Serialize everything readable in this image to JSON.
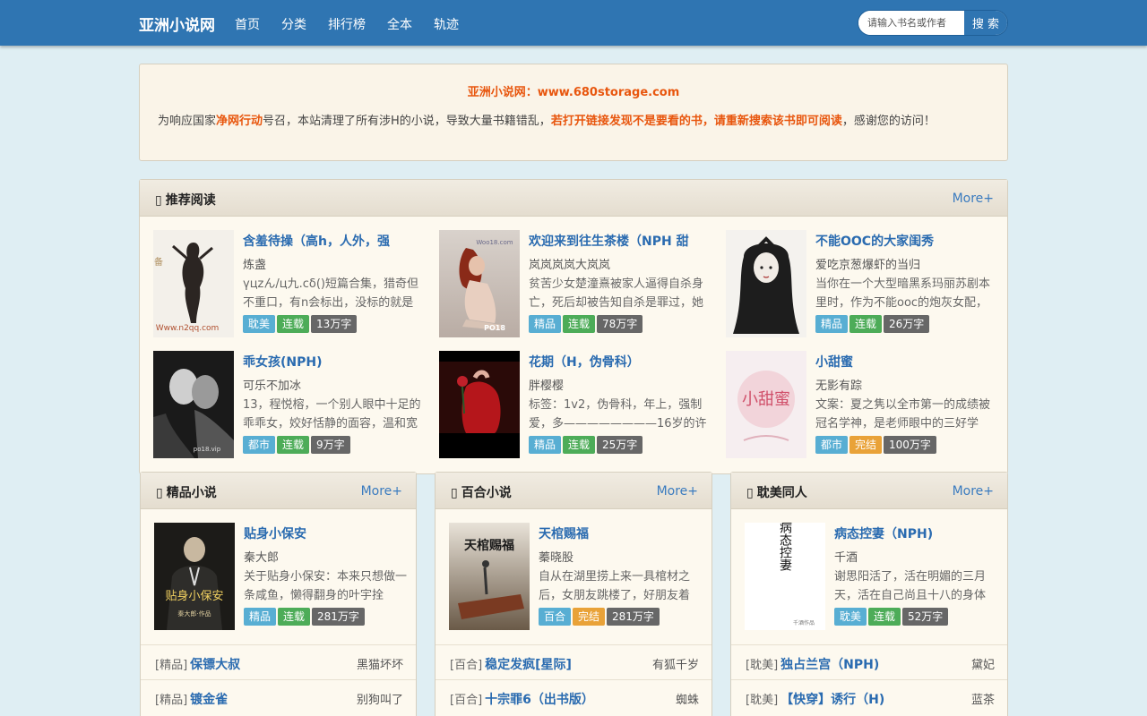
{
  "header": {
    "brand": "亚洲小说网",
    "nav": [
      "首页",
      "分类",
      "排行榜",
      "全本",
      "轨迹"
    ],
    "search_placeholder": "请输入书名或作者",
    "search_button": "搜 索"
  },
  "notice": {
    "title": "亚洲小说网：www.680storage.com",
    "part1": "为响应国家",
    "highlight1": "净网行动",
    "part2": "号召，本站清理了所有涉H的小说，导致大量书籍错乱，",
    "highlight2": "若打开链接发现不是要看的书，请重新搜索该书即可阅读",
    "part3": "，感谢您的访问！"
  },
  "recommend": {
    "title": "推荐阅读",
    "more": "More+",
    "books": [
      {
        "title": "含羞待操（高h，人外，强",
        "author": "炼盏",
        "desc": "үцzん/ц九.cδ()短篇合集，猎奇但不重口，有n会标出，没标的就是",
        "tags": [
          "耽美",
          "连载",
          "13万字"
        ]
      },
      {
        "title": "欢迎来到往生茶楼（NPH 甜",
        "author": "岚岚岚岚大岚岚",
        "desc": "贫苦少女楚潼熹被家人逼得自杀身亡，死后却被告知自杀是罪过，她",
        "tags": [
          "精品",
          "连载",
          "78万字"
        ]
      },
      {
        "title": "不能OOC的大家闺秀",
        "author": "爱吃京葱爆虾的当归",
        "desc": "当你在一个大型暗黑系玛丽苏剧本里时，作为不能ooc的炮灰女配，",
        "tags": [
          "精品",
          "连载",
          "26万字"
        ]
      },
      {
        "title": "乖女孩(NPH)",
        "author": "可乐不加冰",
        "desc": "13，程悦榕，一个别人眼中十足的乖乖女，姣好恬静的面容，温和宽",
        "tags": [
          "都市",
          "连载",
          "9万字"
        ]
      },
      {
        "title": "花期（H，伪骨科）",
        "author": "胖樱樱",
        "desc": "标签：1v2，伪骨科，年上，强制爱，多————————16岁的许",
        "tags": [
          "精品",
          "连载",
          "25万字"
        ]
      },
      {
        "title": "小甜蜜",
        "author": "无影有踪",
        "desc": "文案：夏之隽以全市第一的成绩被冠名学神，是老师眼中的三好学",
        "tags": [
          "都市",
          "完结",
          "100万字"
        ]
      }
    ]
  },
  "sections": [
    {
      "title": "精品小说",
      "more": "More+",
      "featured": {
        "title": "贴身小保安",
        "author": "秦大郎",
        "desc": "关于贴身小保安：本来只想做一条咸鱼，懒得翻身的叶宇拴",
        "tags": [
          "精品",
          "连载",
          "281万字"
        ]
      },
      "list": [
        {
          "cat": "[精品]",
          "title": "保镖大叔",
          "author": "黑猫坏坏"
        },
        {
          "cat": "[精品]",
          "title": "镀金雀",
          "author": "别狗叫了"
        }
      ]
    },
    {
      "title": "百合小说",
      "more": "More+",
      "featured": {
        "title": "天棺赐福",
        "author": "蓁晓股",
        "desc": "自从在湖里捞上来一具棺材之后，女朋友跳楼了，好朋友着",
        "tags": [
          "百合",
          "完结",
          "281万字"
        ]
      },
      "list": [
        {
          "cat": "[百合]",
          "title": "稳定发疯[星际]",
          "author": "有狐千岁"
        },
        {
          "cat": "[百合]",
          "title": "十宗罪6（出书版）",
          "author": "蜘蛛"
        }
      ]
    },
    {
      "title": "耽美同人",
      "more": "More+",
      "featured": {
        "title": "病态控妻（NPH)",
        "author": "千酒",
        "desc": "谢思阳活了，活在明媚的三月天，活在自己尚且十八的身体",
        "tags": [
          "耽美",
          "连载",
          "52万字"
        ]
      },
      "list": [
        {
          "cat": "[耽美]",
          "title": "独占兰宫（NPH)",
          "author": "黛妃"
        },
        {
          "cat": "[耽美]",
          "title": "【快穿】诱行（H)",
          "author": "蓝茶"
        }
      ]
    }
  ],
  "covers": {
    "c1_text": "备用网址",
    "c1_url": "Www.n2qq.com",
    "c2_text": "Woo18.com",
    "c2_sub": "PO18",
    "c4_text": "po18.vip",
    "c6_text": "小甜蜜",
    "s1_text": "贴身小保安",
    "s1_sub": "秦大郎·作品",
    "s2_text": "天棺赐福",
    "s3_text": "病态控妻",
    "s3_sub": "千酒作品"
  },
  "colors": {
    "header_bg": "#2f75b2",
    "link_blue": "#2a6bb0",
    "highlight_orange": "#e8560e",
    "tag_blue": "#58aed3",
    "tag_green": "#4dac58",
    "tag_gray": "#676767",
    "tag_orange": "#e9a238"
  }
}
